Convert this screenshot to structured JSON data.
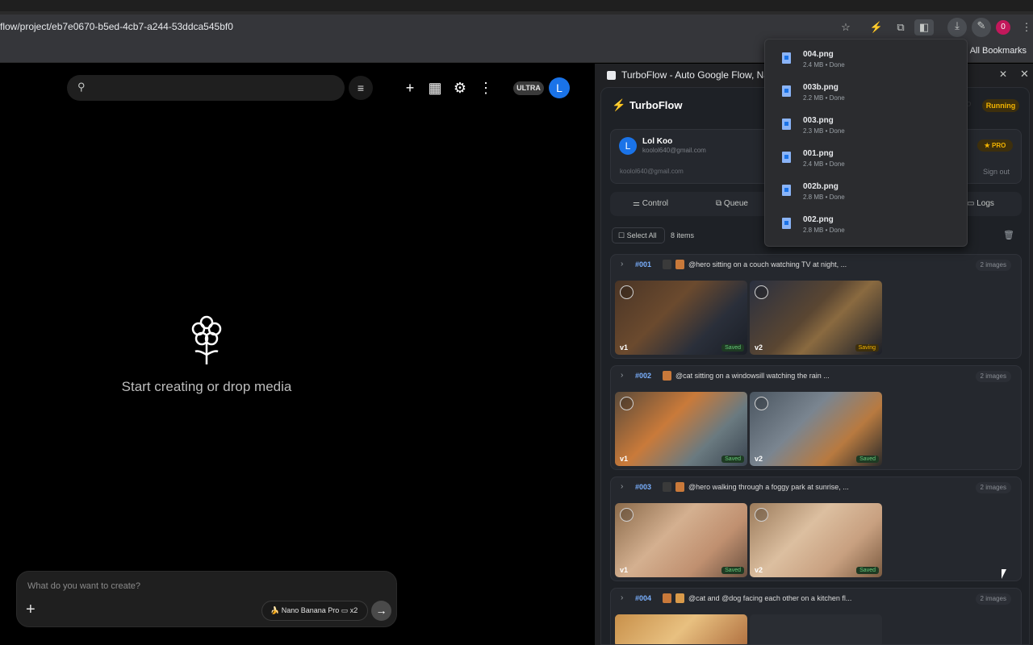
{
  "browser": {
    "url": "flow/project/eb7e0670-b5ed-4cb7-a244-53ddca545bf0",
    "all_bookmarks": "All Bookmarks",
    "profile_initial": "0"
  },
  "app": {
    "ultra_badge": "ULTRA",
    "avatar_initial": "L",
    "empty_state": "Start creating or drop media",
    "composer_placeholder": "What do you want to create?",
    "model_chip": "Nano Banana Pro",
    "multiplier": "x2"
  },
  "side_panel": {
    "tab_title": "TurboFlow - Auto Google Flow, Nar",
    "ext_name": "TurboFlow",
    "status": "Running",
    "user": {
      "initial": "L",
      "name": "Lol Koo",
      "email": "koolol640@gmail.com",
      "email2": "koolol640@gmail.com",
      "plan": "★ PRO",
      "signout": "Sign out"
    },
    "tabs": [
      "Control",
      "Queue",
      "Logs"
    ],
    "select_all": "Select All",
    "items_count": "8 items"
  },
  "queue": [
    {
      "id": "#001",
      "prompt": "@hero sitting on a couch watching TV at night, ...",
      "count": "2 images",
      "images": [
        {
          "ver": "v1",
          "status": "Saved"
        },
        {
          "ver": "v2",
          "status": "Saving"
        }
      ]
    },
    {
      "id": "#002",
      "prompt": "@cat sitting on a windowsill watching the rain ...",
      "count": "2 images",
      "images": [
        {
          "ver": "v1",
          "status": "Saved"
        },
        {
          "ver": "v2",
          "status": "Saved"
        }
      ]
    },
    {
      "id": "#003",
      "prompt": "@hero walking through a foggy park at sunrise, ...",
      "count": "2 images",
      "images": [
        {
          "ver": "v1",
          "status": "Saved"
        },
        {
          "ver": "v2",
          "status": "Saved"
        }
      ]
    },
    {
      "id": "#004",
      "prompt": "@cat and @dog facing each other on a kitchen fl...",
      "count": "2 images",
      "images": []
    }
  ],
  "downloads": [
    {
      "name": "004.png",
      "meta": "2.4 MB • Done"
    },
    {
      "name": "003b.png",
      "meta": "2.2 MB • Done"
    },
    {
      "name": "003.png",
      "meta": "2.3 MB • Done"
    },
    {
      "name": "001.png",
      "meta": "2.4 MB • Done"
    },
    {
      "name": "002b.png",
      "meta": "2.8 MB • Done"
    },
    {
      "name": "002.png",
      "meta": "2.8 MB • Done"
    }
  ]
}
